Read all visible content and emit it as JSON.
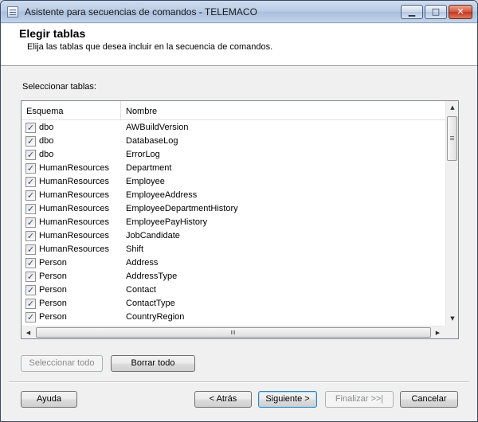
{
  "window": {
    "title": "Asistente para secuencias de comandos - TELEMACO",
    "minimize_glyph": "▁",
    "maximize_glyph": "□",
    "close_glyph": "✕"
  },
  "header": {
    "title": "Elegir tablas",
    "subtitle": "Elija las tablas que desea incluir en la secuencia de comandos."
  },
  "select_label": "Seleccionar tablas:",
  "grid": {
    "columns": [
      "Esquema",
      "Nombre"
    ],
    "check_glyph": "✓",
    "rows": [
      {
        "schema": "dbo",
        "name": "AWBuildVersion",
        "checked": true
      },
      {
        "schema": "dbo",
        "name": "DatabaseLog",
        "checked": true
      },
      {
        "schema": "dbo",
        "name": "ErrorLog",
        "checked": true
      },
      {
        "schema": "HumanResources",
        "name": "Department",
        "checked": true
      },
      {
        "schema": "HumanResources",
        "name": "Employee",
        "checked": true
      },
      {
        "schema": "HumanResources",
        "name": "EmployeeAddress",
        "checked": true
      },
      {
        "schema": "HumanResources",
        "name": "EmployeeDepartmentHistory",
        "checked": true
      },
      {
        "schema": "HumanResources",
        "name": "EmployeePayHistory",
        "checked": true
      },
      {
        "schema": "HumanResources",
        "name": "JobCandidate",
        "checked": true
      },
      {
        "schema": "HumanResources",
        "name": "Shift",
        "checked": true
      },
      {
        "schema": "Person",
        "name": "Address",
        "checked": true
      },
      {
        "schema": "Person",
        "name": "AddressType",
        "checked": true
      },
      {
        "schema": "Person",
        "name": "Contact",
        "checked": true
      },
      {
        "schema": "Person",
        "name": "ContactType",
        "checked": true
      },
      {
        "schema": "Person",
        "name": "CountryRegion",
        "checked": true
      }
    ],
    "scroll_up_glyph": "▲",
    "scroll_down_glyph": "▼",
    "scroll_left_glyph": "◀",
    "scroll_right_glyph": "▶"
  },
  "buttons": {
    "select_all": "Seleccionar todo",
    "clear_all": "Borrar todo",
    "help": "Ayuda",
    "back": "< Atrás",
    "next": "Siguiente >",
    "finish": "Finalizar >>|",
    "cancel": "Cancelar"
  }
}
